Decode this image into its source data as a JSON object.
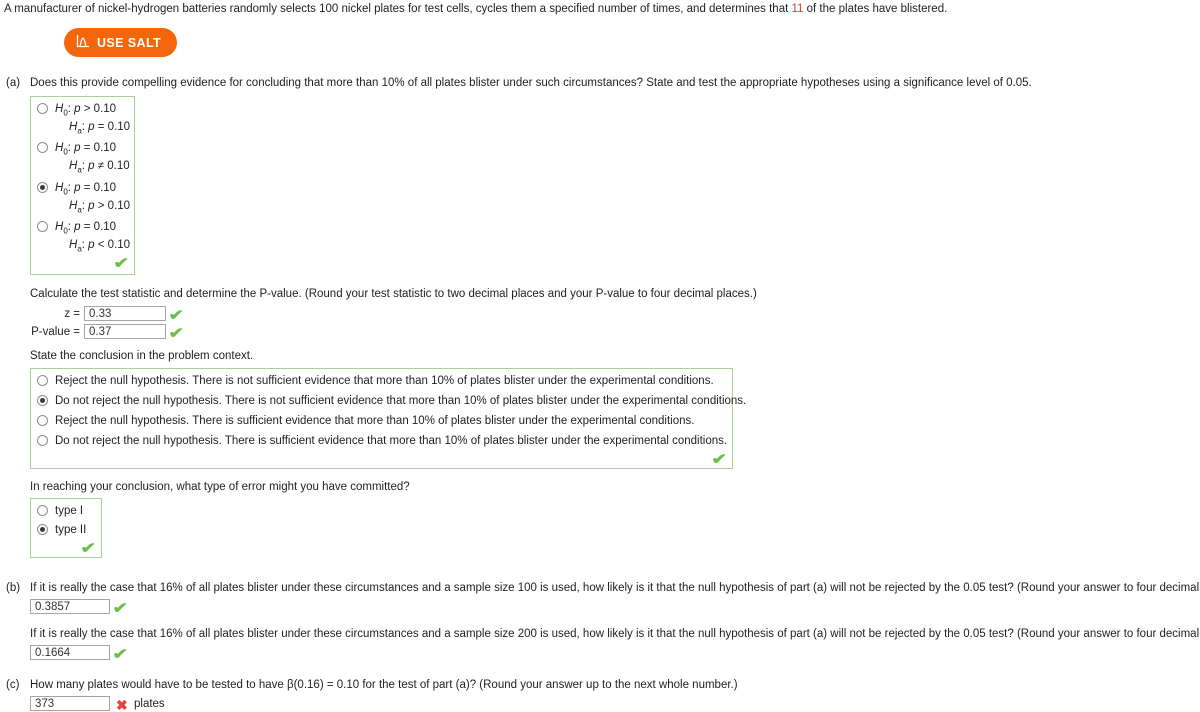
{
  "intro": {
    "before_count": "A manufacturer of nickel-hydrogen batteries randomly selects 100 nickel plates for test cells, cycles them a specified number of times, and determines that ",
    "count": "11",
    "after_count": " of the plates have blistered.",
    "count_color": "#e03a2f"
  },
  "salt_button": {
    "label": "USE SALT",
    "icon": "distribution-curve-icon",
    "color": "#f4660c"
  },
  "parts": {
    "a": {
      "label": "(a)",
      "question": "Does this provide compelling evidence for concluding that more than 10% of all plates blister under such circumstances? State and test the appropriate hypotheses using a significance level of 0.05.",
      "hypothesis_options": [
        {
          "null": "H0: p > 0.10",
          "alt": "Ha: p = 0.10",
          "selected": false
        },
        {
          "null": "H0: p = 0.10",
          "alt": "Ha: p ≠ 0.10",
          "selected": false
        },
        {
          "null": "H0: p = 0.10",
          "alt": "Ha: p > 0.10",
          "selected": true
        },
        {
          "null": "H0: p = 0.10",
          "alt": "Ha: p < 0.10",
          "selected": false
        }
      ],
      "hypothesis_status": "correct",
      "stat_instruction": "Calculate the test statistic and determine the P-value. (Round your test statistic to two decimal places and your P-value to four decimal places.)",
      "z_label": "z  =",
      "z_value": "0.33",
      "z_status": "correct",
      "p_label": "P-value  =",
      "p_value": "0.37",
      "p_status": "correct",
      "conclusion_prompt": "State the conclusion in the problem context.",
      "conclusion_options": [
        {
          "text": "Reject the null hypothesis. There is not sufficient evidence that more than 10% of plates blister under the experimental conditions.",
          "selected": false
        },
        {
          "text": "Do not reject the null hypothesis. There is not sufficient evidence that more than 10% of plates blister under the experimental conditions.",
          "selected": true
        },
        {
          "text": "Reject the null hypothesis. There is sufficient evidence that more than 10% of plates blister under the experimental conditions.",
          "selected": false
        },
        {
          "text": "Do not reject the null hypothesis. There is sufficient evidence that more than 10% of plates blister under the experimental conditions.",
          "selected": false
        }
      ],
      "conclusion_status": "correct",
      "error_prompt": "In reaching your conclusion, what type of error might you have committed?",
      "error_options": [
        {
          "text": "type I",
          "selected": false
        },
        {
          "text": "type II",
          "selected": true
        }
      ],
      "error_status": "correct"
    },
    "b": {
      "label": "(b)",
      "question1": "If it is really the case that 16% of all plates blister under these circumstances and a sample size 100 is used, how likely is it that the null hypothesis of part (a) will not be rejected by the 0.05 test? (Round your answer to four decimal places.)",
      "answer1": "0.3857",
      "status1": "correct",
      "question2": "If it is really the case that 16% of all plates blister under these circumstances and a sample size 200 is used, how likely is it that the null hypothesis of part (a) will not be rejected by the 0.05 test? (Round your answer to four decimal places.)",
      "answer2": "0.1664",
      "status2": "correct"
    },
    "c": {
      "label": "(c)",
      "question": "How many plates would have to be tested to have β(0.16) = 0.10 for the test of part (a)? (Round your answer up to the next whole number.)",
      "answer": "373",
      "status": "incorrect",
      "unit": "plates"
    }
  },
  "icons": {
    "check": "✔",
    "cross": "✖"
  }
}
